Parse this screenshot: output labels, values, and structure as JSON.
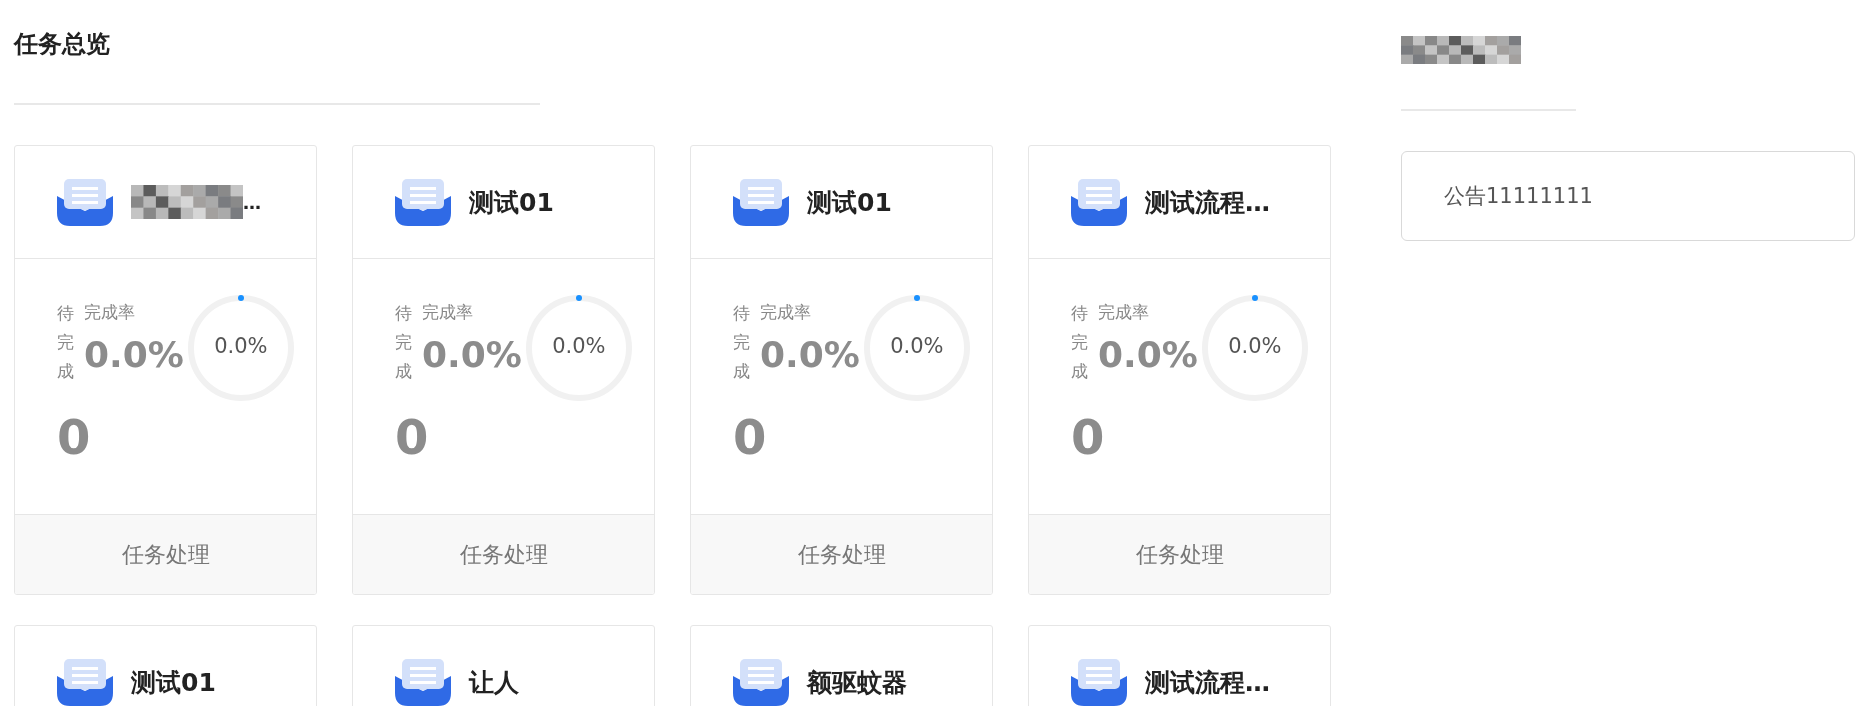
{
  "overview": {
    "title": "任务总览"
  },
  "tasks": [
    {
      "title": "…",
      "title_redacted": true,
      "pending_label": "待完成",
      "pending_count": "0",
      "rate_label": "完成率",
      "rate": "0.0%",
      "gauge_label": "0.0%",
      "action": "任务处理"
    },
    {
      "title": "测试01",
      "title_redacted": false,
      "pending_label": "待完成",
      "pending_count": "0",
      "rate_label": "完成率",
      "rate": "0.0%",
      "gauge_label": "0.0%",
      "action": "任务处理"
    },
    {
      "title": "测试01",
      "title_redacted": false,
      "pending_label": "待完成",
      "pending_count": "0",
      "rate_label": "完成率",
      "rate": "0.0%",
      "gauge_label": "0.0%",
      "action": "任务处理"
    },
    {
      "title": "测试流程…",
      "title_redacted": false,
      "pending_label": "待完成",
      "pending_count": "0",
      "rate_label": "完成率",
      "rate": "0.0%",
      "gauge_label": "0.0%",
      "action": "任务处理"
    },
    {
      "title": "测试01",
      "title_redacted": false
    },
    {
      "title": "让人",
      "title_redacted": false
    },
    {
      "title": "额驱蚊器",
      "title_redacted": false
    },
    {
      "title": "测试流程…",
      "title_redacted": false
    }
  ],
  "notices": {
    "title_redacted": true,
    "items": [
      "公告11111111"
    ]
  }
}
